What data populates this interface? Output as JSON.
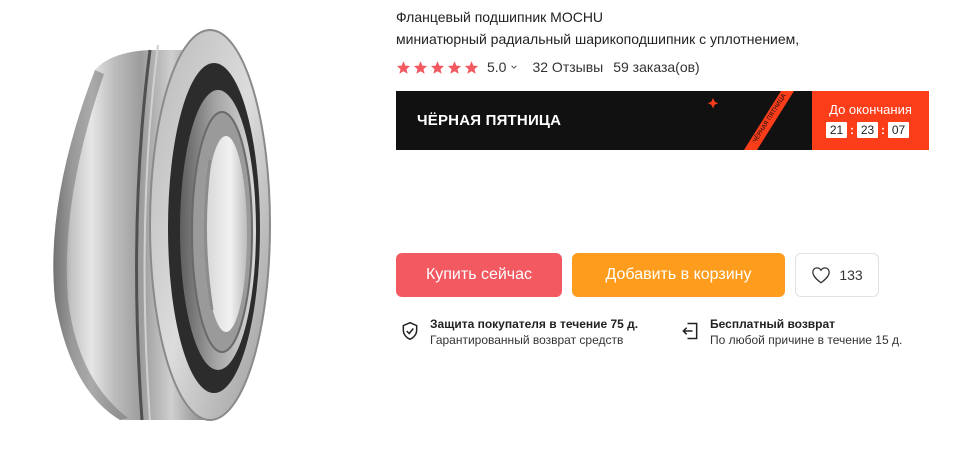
{
  "product": {
    "title_line1": "Фланцевый подшипник MOCHU",
    "title_line2": "миниатюрный радиальный шарикоподшипник с уплотнением,",
    "rating": "5.0",
    "reviews": "32 Отзывы",
    "orders": "59 заказа(ов)",
    "star_color": "#f25961"
  },
  "promo": {
    "title": "ЧЁРНАЯ ПЯТНИЦА",
    "ribbon_text": "ЧЁРНАЯ ПЯТНИЦА",
    "timer_label": "До окончания",
    "hours": "21",
    "minutes": "23",
    "seconds": "07",
    "accent": "#fc3d1a"
  },
  "actions": {
    "buy_label": "Купить сейчас",
    "cart_label": "Добавить в корзину",
    "wishlist_count": "133",
    "buy_color": "#f25961",
    "cart_color": "#fe9d1d"
  },
  "guarantees": [
    {
      "icon": "shield-check-icon",
      "title": "Защита покупателя в течение 75 д.",
      "subtitle": "Гарантированный возврат средств"
    },
    {
      "icon": "return-arrow-icon",
      "title": "Бесплатный возврат",
      "subtitle": "По любой причине в течение 15 д."
    }
  ]
}
